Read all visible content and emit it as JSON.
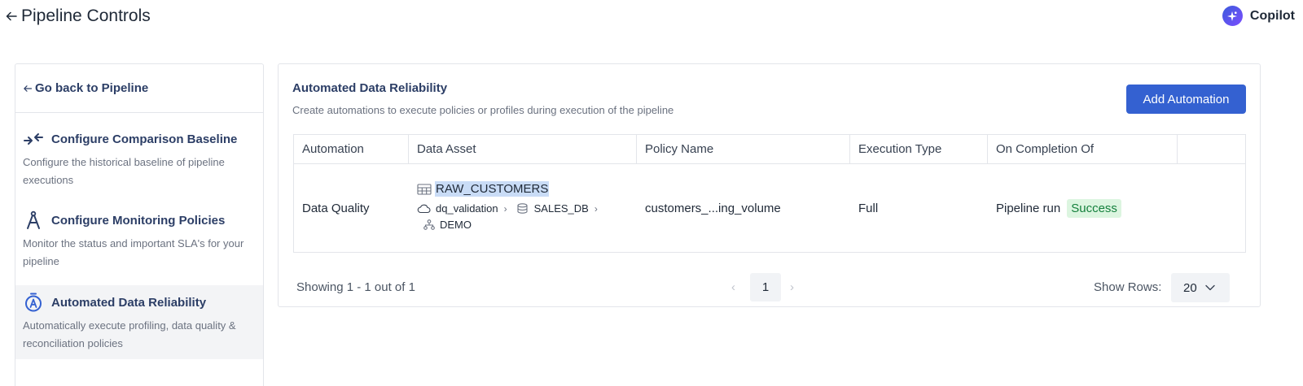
{
  "header": {
    "title": "Pipeline Controls",
    "copilot_label": "Copilot"
  },
  "sidebar": {
    "back_label": "Go back to Pipeline",
    "items": [
      {
        "title": "Configure Comparison Baseline",
        "description": "Configure the historical baseline of pipeline executions",
        "icon": "compare-arrows-icon"
      },
      {
        "title": "Configure Monitoring Policies",
        "description": "Monitor the status and important SLA's for your pipeline",
        "icon": "compass-icon"
      },
      {
        "title": "Automated Data Reliability",
        "description": "Automatically execute profiling, data quality & reconciliation policies",
        "icon": "stopwatch-a-icon",
        "active": true
      }
    ]
  },
  "main": {
    "title": "Automated Data Reliability",
    "subtitle": "Create automations to execute policies or profiles during execution of the pipeline",
    "add_button": "Add Automation",
    "columns": [
      "Automation",
      "Data Asset",
      "Policy Name",
      "Execution Type",
      "On Completion Of",
      ""
    ],
    "rows": [
      {
        "automation": "Data Quality",
        "asset": {
          "name": "RAW_CUSTOMERS",
          "datasource": "dq_validation",
          "database": "SALES_DB",
          "schema": "DEMO"
        },
        "policy": "customers_...ing_volume",
        "execution_type": "Full",
        "completion_of": "Pipeline run",
        "status": "Success"
      }
    ],
    "pager": {
      "info": "Showing 1 - 1 out of 1",
      "current_page": "1",
      "prev": "‹",
      "next": "›",
      "rows_label": "Show Rows:",
      "rows_value": "20"
    }
  },
  "colors": {
    "primary": "#3461d1",
    "heading": "#2c3e66",
    "success_bg": "#dcf5e0",
    "success_text": "#15803d"
  }
}
